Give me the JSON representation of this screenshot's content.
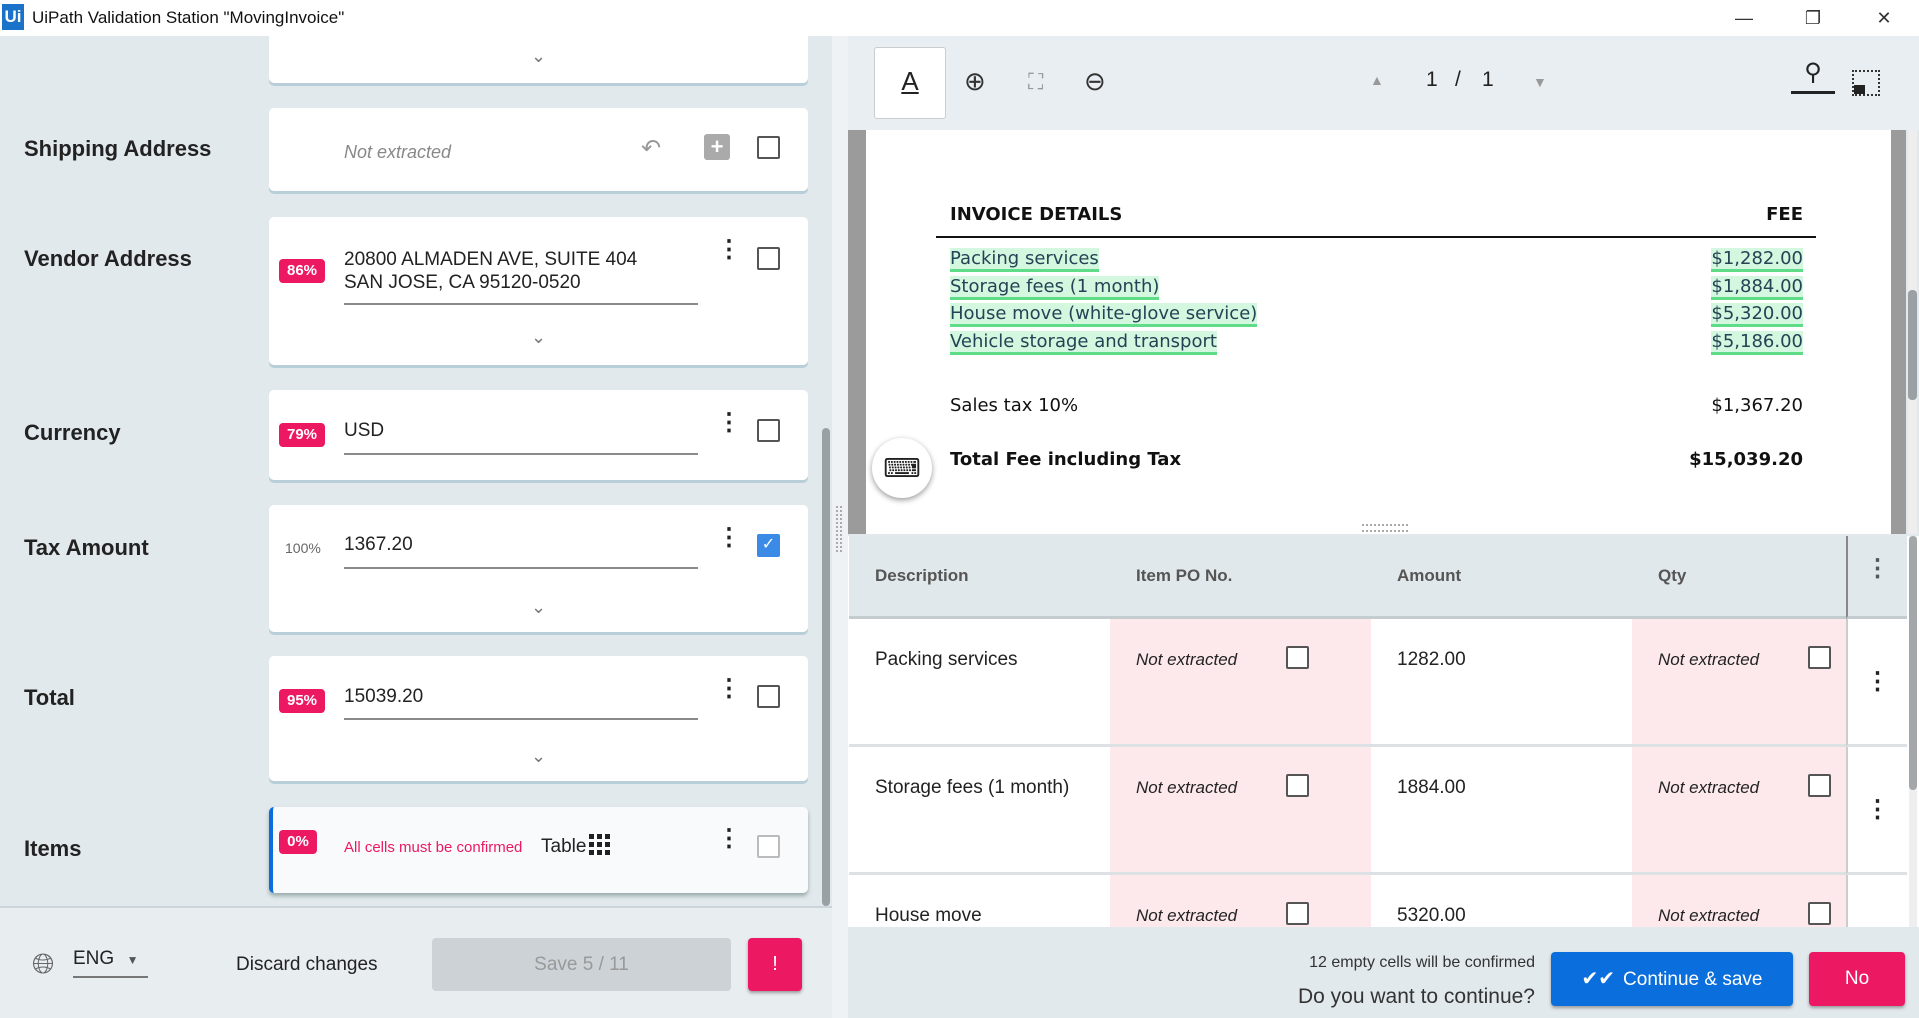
{
  "window": {
    "logo": "Ui",
    "title": "UiPath Validation Station \"MovingInvoice\"",
    "minimize": "—",
    "restore": "❐",
    "close": "✕"
  },
  "fields": [
    {
      "label": "Shipping Address",
      "value": "Not extracted",
      "confidence": null,
      "confirmed": false
    },
    {
      "label": "Vendor Address",
      "value_line1": "20800 ALMADEN AVE, SUITE 404",
      "value_line2": "SAN JOSE, CA 95120-0520",
      "confidence": "86%",
      "confirmed": false
    },
    {
      "label": "Currency",
      "value": "USD",
      "confidence": "79%",
      "confirmed": false
    },
    {
      "label": "Tax Amount",
      "value": "1367.20",
      "confidence": "100%",
      "confirmed": true
    },
    {
      "label": "Total",
      "value": "15039.20",
      "confidence": "95%",
      "confirmed": false
    },
    {
      "label": "Items",
      "confidence": "0%",
      "message": "All cells must be confirmed",
      "type_label": "Table",
      "confirmed": false
    }
  ],
  "footer": {
    "language": "ENG",
    "discard": "Discard changes",
    "save": "Save 5 / 11",
    "alert": "!"
  },
  "viewer": {
    "text_tool": "A",
    "page_current": "1",
    "page_sep": "/",
    "page_total": "1"
  },
  "document": {
    "header_left": "INVOICE DETAILS",
    "header_right": "FEE",
    "rows": [
      {
        "desc": "Packing services",
        "fee": "$1,282.00"
      },
      {
        "desc": "Storage fees (1 month)",
        "fee": "$1,884.00"
      },
      {
        "desc": "House move (white-glove service)",
        "fee": "$5,320.00"
      },
      {
        "desc": "Vehicle storage and transport",
        "fee": "$5,186.00"
      }
    ],
    "tax_label": "Sales tax 10%",
    "tax_value": "$1,367.20",
    "total_label": "Total Fee including Tax",
    "total_value": "$15,039.20"
  },
  "table": {
    "columns": [
      "Description",
      "Item PO No.",
      "Amount",
      "Qty"
    ],
    "rows": [
      {
        "desc": "Packing services",
        "po": "Not extracted",
        "amount": "1282.00",
        "qty": "Not extracted"
      },
      {
        "desc": "Storage fees (1 month)",
        "po": "Not extracted",
        "amount": "1884.00",
        "qty": "Not extracted"
      },
      {
        "desc": "House move",
        "po": "Not extracted",
        "amount": "5320.00",
        "qty": "Not extracted"
      }
    ]
  },
  "confirm": {
    "note": "12 empty cells will be confirmed",
    "question": "Do you want to continue?",
    "continue": "Continue & save",
    "no": "No"
  },
  "colors": {
    "accent": "#0a6fdc",
    "danger": "#ec1962",
    "highlight": "#5fdc87"
  }
}
